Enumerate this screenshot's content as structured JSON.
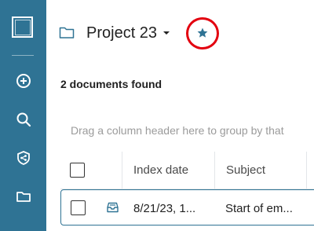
{
  "sidebar": {
    "items": [
      {
        "name": "add",
        "icon": "plus-circle-icon"
      },
      {
        "name": "search",
        "icon": "search-icon"
      },
      {
        "name": "shield",
        "icon": "shield-share-icon"
      },
      {
        "name": "folder",
        "icon": "folder-icon"
      }
    ],
    "background": "#2f7394"
  },
  "header": {
    "project_name": "Project 23",
    "favorite_icon": "star-icon",
    "favorite_highlight_color": "#e3000f"
  },
  "results": {
    "count_text": "2 documents found"
  },
  "grid": {
    "group_hint": "Drag a column header here to group by that",
    "columns": [
      "Index date",
      "Subject"
    ],
    "rows": [
      {
        "type_icon": "inbox-tray-icon",
        "index_date": "8/21/23, 1...",
        "subject": "Start of em..."
      }
    ]
  }
}
